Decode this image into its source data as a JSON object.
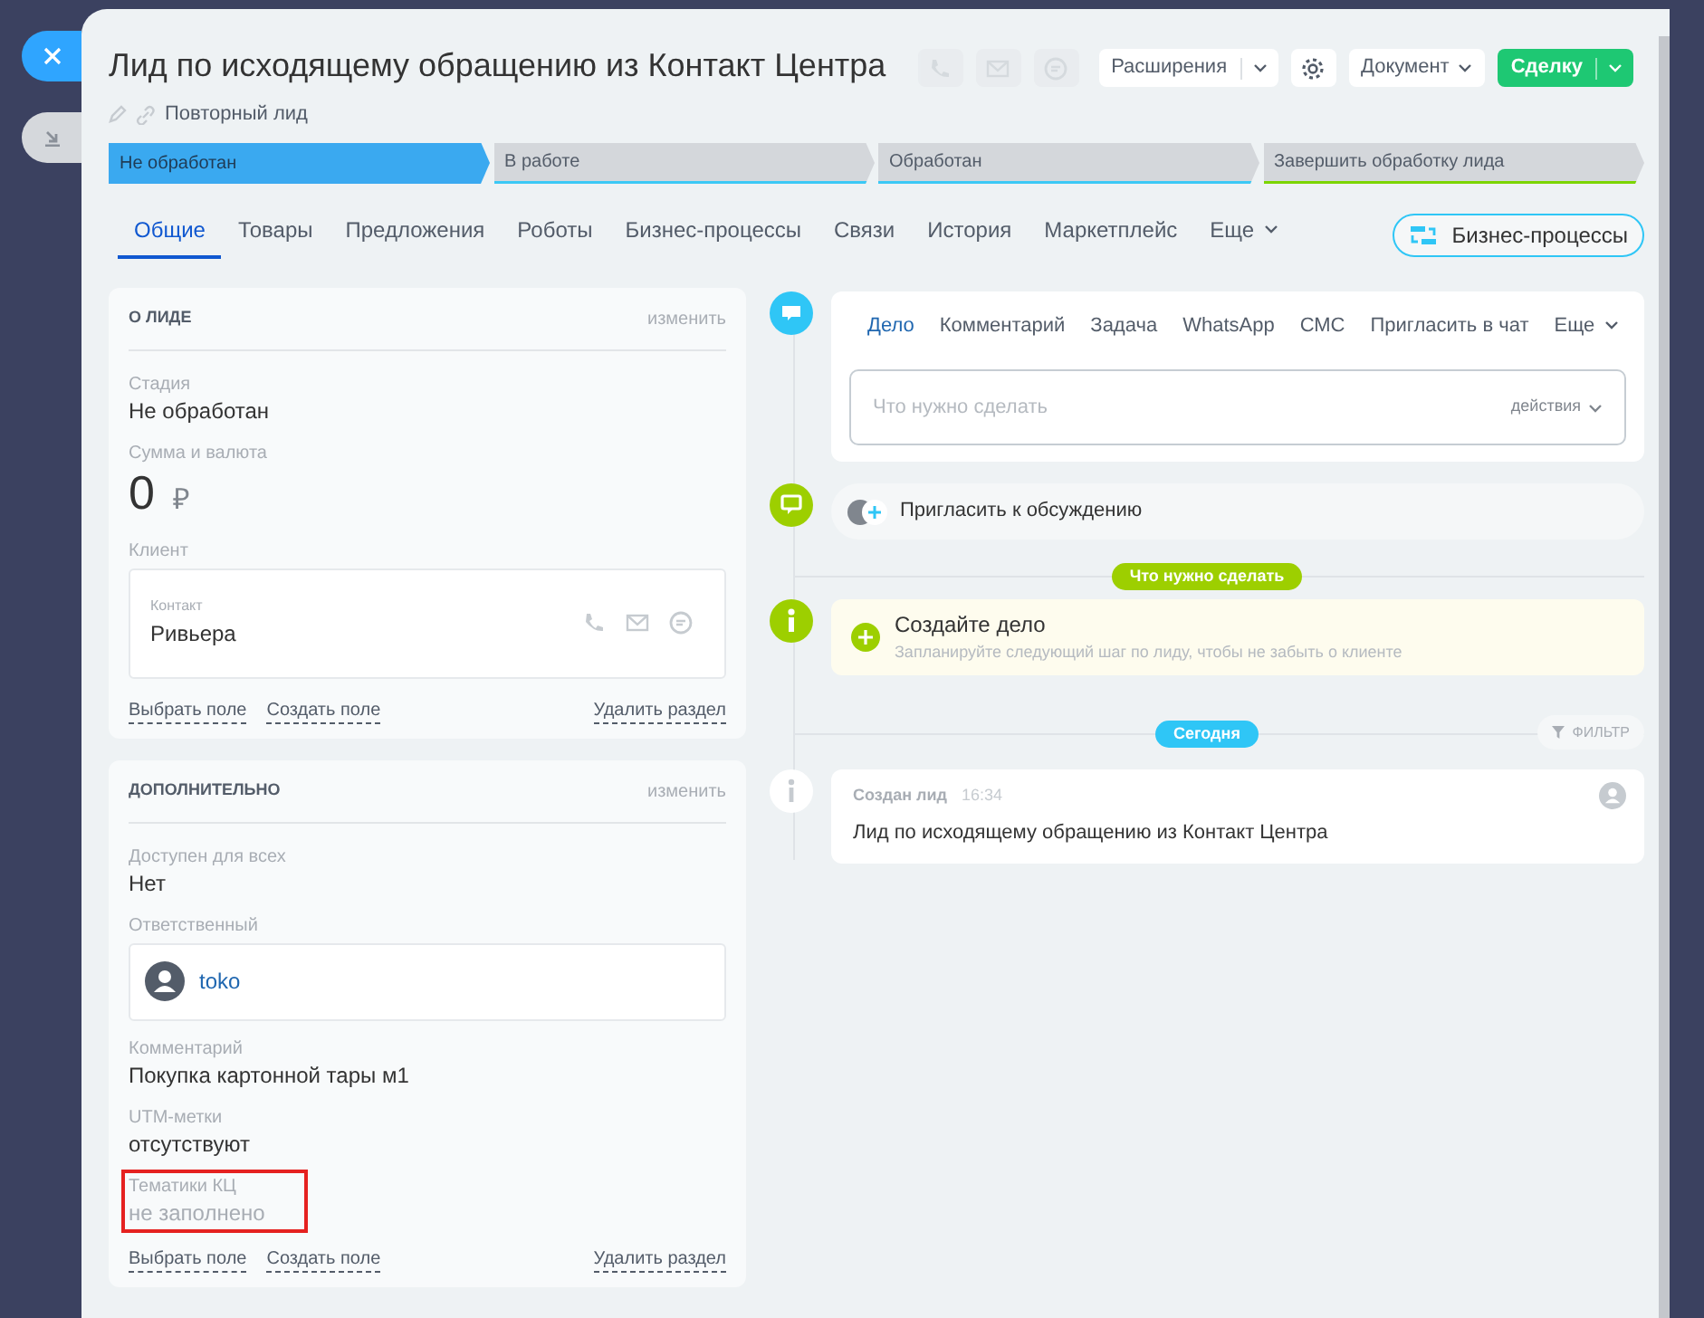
{
  "side_buttons": [
    {
      "selected": true
    },
    {
      "selected": false
    }
  ],
  "header": {
    "title": "Лид по исходящему обращению из Контакт Центра",
    "badge": "Повторный лид",
    "actions": [
      {
        "kind": "icon",
        "disabled": true
      },
      {
        "kind": "icon",
        "disabled": true
      },
      {
        "kind": "icon",
        "disabled": true
      },
      {
        "kind": "split",
        "label": "Расширения",
        "primary": false
      },
      {
        "kind": "icon",
        "disabled": false
      },
      {
        "kind": "dropdown",
        "label": "Документ"
      },
      {
        "kind": "split",
        "label": "Сделку",
        "primary": true
      }
    ]
  },
  "stages": [
    {
      "label": "Не обработан",
      "selected": true,
      "color": "#3aa9f0"
    },
    {
      "label": "В работе",
      "selected": false,
      "color": "#3bc8f5"
    },
    {
      "label": "Обработан",
      "selected": false,
      "color": "#3bc8f5"
    },
    {
      "label": "Завершить обработку лида",
      "selected": false,
      "color": "#7bd500"
    }
  ],
  "tabs": [
    {
      "label": "Общие",
      "selected": true
    },
    {
      "label": "Товары",
      "selected": false
    },
    {
      "label": "Предложения",
      "selected": false
    },
    {
      "label": "Роботы",
      "selected": false
    },
    {
      "label": "Бизнес-процессы",
      "selected": false
    },
    {
      "label": "Связи",
      "selected": false
    },
    {
      "label": "История",
      "selected": false
    },
    {
      "label": "Маркетплейс",
      "selected": false
    },
    {
      "label": "Еще",
      "selected": false,
      "dropdown": true
    }
  ],
  "bp_button": "Бизнес-процессы",
  "sections": [
    {
      "title": "О ЛИДЕ",
      "edit": "изменить",
      "fields": [
        {
          "kind": "text",
          "label": "Стадия",
          "value": "Не обработан"
        },
        {
          "kind": "money",
          "label": "Сумма и валюта",
          "value": "0",
          "currency": "₽"
        },
        {
          "kind": "client",
          "label": "Клиент",
          "sublabel": "Контакт",
          "value": "Ривьера"
        }
      ],
      "links": [
        "Выбрать поле",
        "Создать поле"
      ],
      "delete": "Удалить раздел"
    },
    {
      "title": "ДОПОЛНИТЕЛЬНО",
      "edit": "изменить",
      "fields": [
        {
          "kind": "text",
          "label": "Доступен для всех",
          "value": "Нет"
        },
        {
          "kind": "user",
          "label": "Ответственный",
          "value": "toko"
        },
        {
          "kind": "text",
          "label": "Комментарий",
          "value": "Покупка картонной тары м1"
        },
        {
          "kind": "text",
          "label": "UTM-метки",
          "value": "отсутствуют"
        },
        {
          "kind": "empty",
          "label": "Тематики КЦ",
          "value": "не заполнено",
          "highlighted": true
        }
      ],
      "links": [
        "Выбрать поле",
        "Создать поле"
      ],
      "delete": "Удалить раздел"
    }
  ],
  "timeline": {
    "composer": {
      "tabs": [
        {
          "label": "Дело",
          "selected": true
        },
        {
          "label": "Комментарий",
          "selected": false
        },
        {
          "label": "Задача",
          "selected": false
        },
        {
          "label": "WhatsApp",
          "selected": false
        },
        {
          "label": "СМС",
          "selected": false
        },
        {
          "label": "Пригласить в чат",
          "selected": false
        },
        {
          "label": "Еще",
          "selected": false,
          "dropdown": true
        }
      ],
      "placeholder": "Что нужно сделать",
      "actions": "действия"
    },
    "invite": "Пригласить к обсуждению",
    "todo_badge": "Что нужно сделать",
    "create": {
      "title": "Создайте дело",
      "hint": "Запланируйте следующий шаг по лиду, чтобы не забыть о клиенте"
    },
    "today_badge": "Сегодня",
    "filter": "ФИЛЬТР",
    "events": [
      {
        "title": "Создан лид",
        "time": "16:34",
        "text": "Лид по исходящему обращению из Контакт Центра"
      }
    ]
  }
}
